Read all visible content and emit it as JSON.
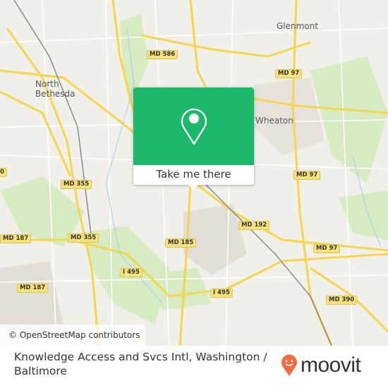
{
  "map": {
    "places": [
      "Glenmont",
      "North\nBethesda",
      "Wheaton"
    ],
    "road_labels": [
      "MD 586",
      "MD 97",
      "MD 97",
      "MD 97",
      "MD 355",
      "MD 355",
      "MD 187",
      "MD 187",
      "MD 192",
      "MD 185",
      "I 495",
      "I 495",
      "MD 390",
      "0"
    ],
    "attribution": "© OpenStreetMap contributors",
    "colors": {
      "land": "#f1efe9",
      "park": "#d6ebc2",
      "road_major": "#f5d64a",
      "road_minor": "#ffffff",
      "rail": "#8a8a8a",
      "water": "#a9cde8"
    }
  },
  "popup": {
    "icon": "map-pin-icon",
    "button_label": "Take me there",
    "color": "#1db86a"
  },
  "footer": {
    "title": "Knowledge Access and Svcs Intl, Washington / Baltimore",
    "logo_text": "moovit",
    "logo_color": "#f26a3d"
  }
}
